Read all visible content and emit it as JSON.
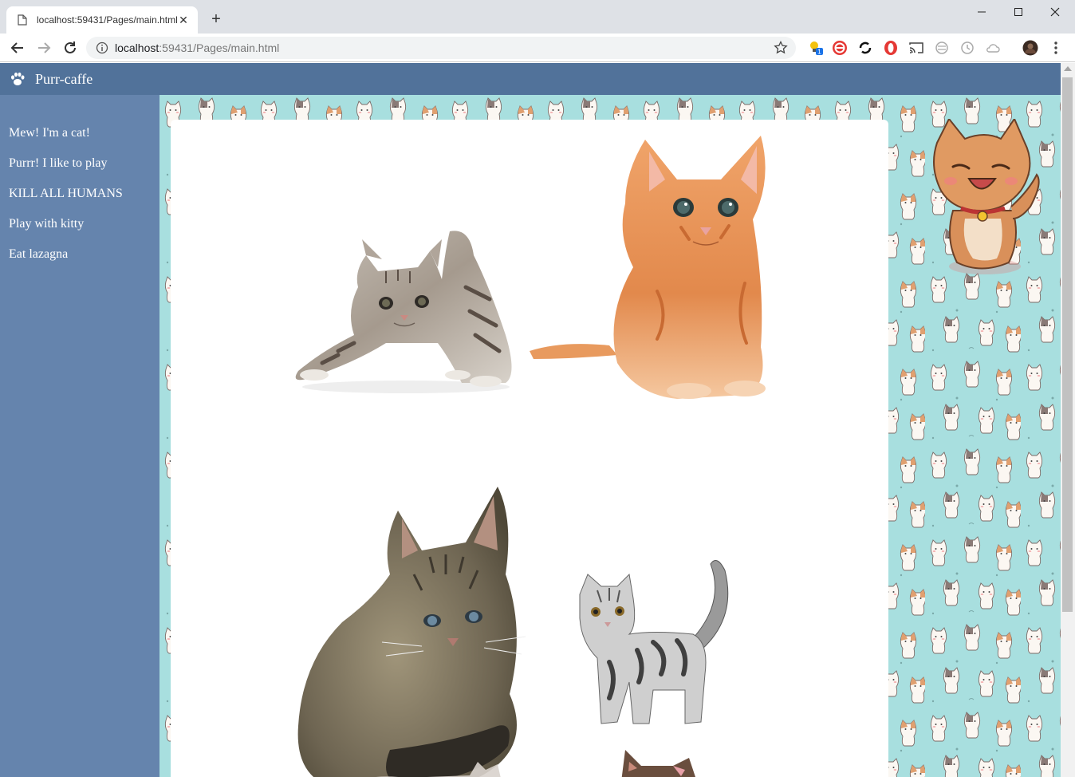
{
  "browser": {
    "tab_title": "localhost:59431/Pages/main.html",
    "url_host": "localhost",
    "url_rest": ":59431/Pages/main.html",
    "extension_badge": "1"
  },
  "site": {
    "brand": "Purr-caffe",
    "nav": [
      {
        "label": "Mew! I'm a cat!"
      },
      {
        "label": "Purrr! I like to play"
      },
      {
        "label": "KILL ALL HUMANS"
      },
      {
        "label": "Play with kitty"
      },
      {
        "label": "Eat lazagna"
      }
    ],
    "colors": {
      "header": "#51729a",
      "sidebar": "#6584ad",
      "pattern_bg": "#a8dfdf"
    }
  },
  "gallery": [
    {
      "name": "tabby-kitten-crouching"
    },
    {
      "name": "orange-kitten-sitting"
    },
    {
      "name": "grey-tabby-cat-sitting"
    },
    {
      "name": "silver-tabby-kitten-standing"
    },
    {
      "name": "kitten-partial-bottom-left"
    },
    {
      "name": "kitten-partial-bottom-right"
    }
  ]
}
